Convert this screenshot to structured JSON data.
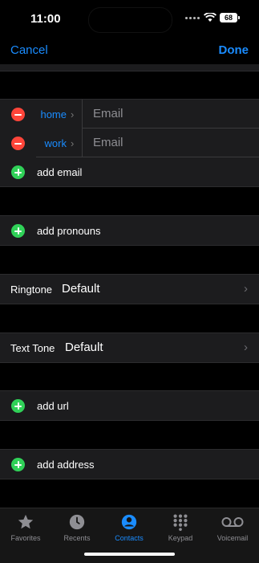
{
  "status": {
    "time": "11:00",
    "battery": "68"
  },
  "nav": {
    "cancel": "Cancel",
    "done": "Done"
  },
  "email_section": {
    "rows": [
      {
        "label": "home",
        "placeholder": "Email"
      },
      {
        "label": "work",
        "placeholder": "Email"
      }
    ],
    "add": "add email"
  },
  "pronouns": {
    "add": "add pronouns"
  },
  "ringtone": {
    "label": "Ringtone",
    "value": "Default"
  },
  "text_tone": {
    "label": "Text Tone",
    "value": "Default"
  },
  "url": {
    "add": "add url"
  },
  "address": {
    "add": "add address"
  },
  "tabbar": {
    "items": [
      {
        "label": "Favorites",
        "icon": "star-icon"
      },
      {
        "label": "Recents",
        "icon": "clock-icon"
      },
      {
        "label": "Contacts",
        "icon": "person-circle-icon"
      },
      {
        "label": "Keypad",
        "icon": "keypad-icon"
      },
      {
        "label": "Voicemail",
        "icon": "voicemail-icon"
      }
    ],
    "active": "Contacts"
  },
  "colors": {
    "accent": "#1a8cff",
    "minus": "#ff453a",
    "plus": "#30d158",
    "section_bg": "#1c1c1e"
  }
}
